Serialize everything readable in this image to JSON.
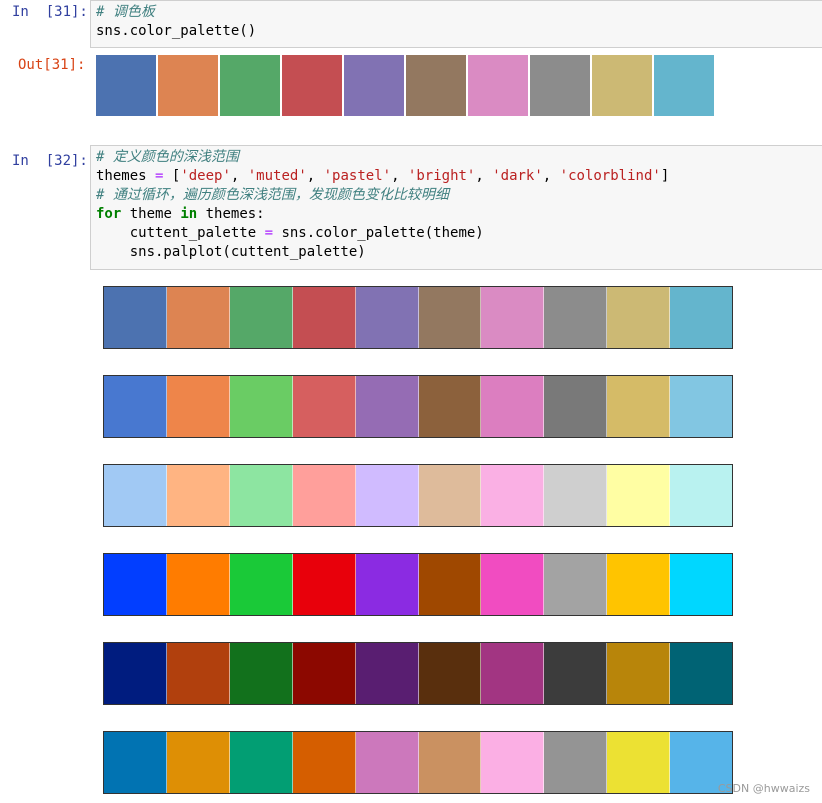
{
  "cells": [
    {
      "in_label": "In  [31]:",
      "code": {
        "line1_comment": "# 调色板",
        "line2": "sns.color_palette()"
      },
      "out_label": "Out[31]:"
    },
    {
      "in_label": "In  [32]:",
      "code": {
        "line1_comment": "# 定义颜色的深浅范围",
        "line2_var": "themes",
        "line2_eq": " = ",
        "line2_open": "[",
        "line2_s1": "'deep'",
        "line2_s2": "'muted'",
        "line2_s3": "'pastel'",
        "line2_s4": "'bright'",
        "line2_s5": "'dark'",
        "line2_s6": "'colorblind'",
        "line2_sep": ", ",
        "line2_close": "]",
        "line3_comment": "# 通过循环，遍历颜色深浅范围，发现颜色变化比较明细",
        "line4_for": "for",
        "line4_mid": " theme ",
        "line4_in": "in",
        "line4_end": " themes:",
        "line5_pre": "    cuttent_palette ",
        "line5_eq": "=",
        "line5_post": " sns.color_palette(theme)",
        "line6": "    sns.palplot(cuttent_palette)"
      }
    }
  ],
  "palettes": {
    "default": [
      "#4c72b0",
      "#dd8452",
      "#55a868",
      "#c44e52",
      "#8172b3",
      "#937860",
      "#da8bc3",
      "#8c8c8c",
      "#ccb974",
      "#64b5cd"
    ],
    "deep": [
      "#4c72b0",
      "#dd8452",
      "#55a868",
      "#c44e52",
      "#8172b3",
      "#937860",
      "#da8bc3",
      "#8c8c8c",
      "#ccb974",
      "#64b5cd"
    ],
    "muted": [
      "#4878d0",
      "#ee854a",
      "#6acc64",
      "#d65f5f",
      "#956cb4",
      "#8c613c",
      "#dc7ec0",
      "#797979",
      "#d5bb67",
      "#82c6e2"
    ],
    "pastel": [
      "#a1c9f4",
      "#ffb482",
      "#8de5a1",
      "#ff9f9b",
      "#d0bbff",
      "#debb9b",
      "#fab0e4",
      "#cfcfcf",
      "#fffea3",
      "#b9f2f0"
    ],
    "bright": [
      "#023eff",
      "#ff7c00",
      "#1ac938",
      "#e8000b",
      "#8b2be2",
      "#9f4800",
      "#f14cc1",
      "#a3a3a3",
      "#ffc400",
      "#00d7ff"
    ],
    "dark": [
      "#001c7f",
      "#b1400d",
      "#12711c",
      "#8c0800",
      "#591e71",
      "#592f0d",
      "#a23582",
      "#3c3c3c",
      "#b8850a",
      "#006374"
    ],
    "colorblind": [
      "#0173b2",
      "#de8f05",
      "#029e73",
      "#d55e00",
      "#cc78bc",
      "#ca9161",
      "#fbafe4",
      "#949494",
      "#ece133",
      "#56b4e9"
    ]
  },
  "watermark": "CSDN @hwwaizs"
}
